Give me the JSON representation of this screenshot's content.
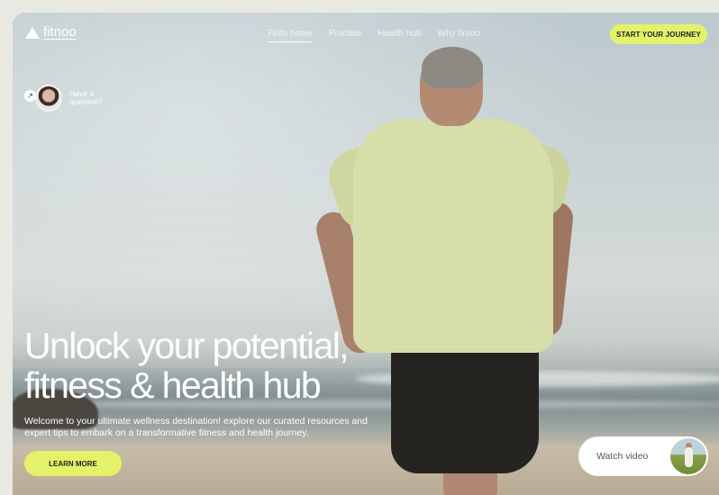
{
  "brand": {
    "name": "fitnoo"
  },
  "nav": {
    "items": [
      {
        "label": "Finto home",
        "active": true
      },
      {
        "label": "Practise",
        "active": false
      },
      {
        "label": "Health hub",
        "active": false
      },
      {
        "label": "Why fintoo",
        "active": false
      }
    ],
    "cta_label": "START YOUR JOURNEY"
  },
  "help": {
    "label": "Have a question?"
  },
  "hero": {
    "title_line1": "Unlock your potential,",
    "title_line2": "fitness & health hub",
    "subtitle": "Welcome to your ultimate wellness destination! explore our curated resources and expert tips to embark on a transformative fitness and health journey.",
    "button_label": "LEARN MORE"
  },
  "video": {
    "label": "Watch video"
  },
  "colors": {
    "accent": "#e4f26a",
    "text_light": "#ffffff"
  }
}
